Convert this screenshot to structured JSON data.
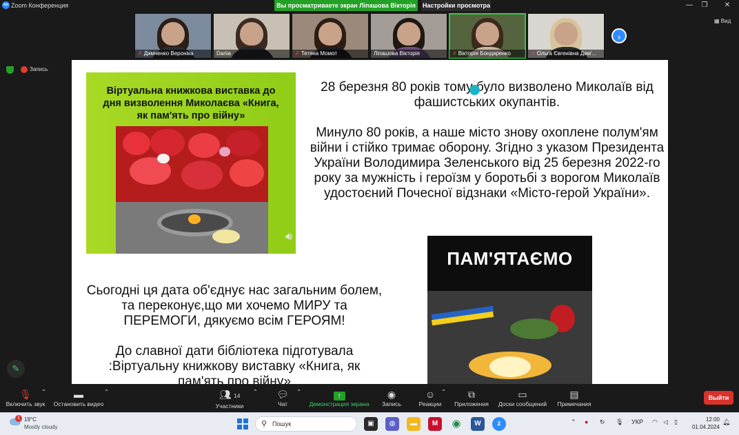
{
  "window": {
    "app_title": "Zoom Конференция",
    "logo": "zm",
    "share_banner": "Вы просматриваете экран Ліпашова Вікторія",
    "view_settings": "Настройки просмотра",
    "controls": [
      "—",
      "❐",
      "✕"
    ]
  },
  "participants": [
    {
      "name": "Димченко Вероніка",
      "muted": true,
      "bg": "#7d8b9e",
      "hair": "#2a1e17",
      "shirt": "#2c2c34"
    },
    {
      "name": "Dariia",
      "muted": false,
      "bg": "#c8c0b4",
      "hair": "#3a2a20",
      "shirt": "#26262a"
    },
    {
      "name": "Тетяна Момот",
      "muted": true,
      "bg": "#9b8a7c",
      "hair": "#2b1d14",
      "shirt": "#1d1d22"
    },
    {
      "name": "Ліпашова Вікторія",
      "muted": false,
      "bg": "#a49c96",
      "hair": "#1f1712",
      "shirt": "#6b4e7a"
    },
    {
      "name": "Вікторія Бондаренко",
      "muted": true,
      "bg": "#55643f",
      "hair": "#3b2a1c",
      "shirt": "#c7b8a4"
    },
    {
      "name": "Ольга Євгенівна Дем'...",
      "muted": true,
      "bg": "#d9d5d0",
      "hair": "#d8c49a",
      "shirt": "#2a2a2e"
    }
  ],
  "view_label": "Вид",
  "recording_label": "Запись",
  "slide": {
    "poster_title": "Віртуальна книжкова виставка до дня визволення Миколаєва «Книга, як пам'ять про війну»",
    "right_p1": "28 березня 80 років тому було визволено Миколаїв від фашистських окупантів.",
    "right_p2": "Минуло 80 років, а наше місто знову охоплене полум'ям війни і стійко тримає оборону. Згідно з указом Президента України Володимира Зеленського від 25 березня 2022-го року за мужність і героїзм у боротьбі з ворогом Миколаїв удостоєний Почесної відзнаки «Місто-герой України».",
    "left_p1": "Сьогодні ця дата об'єднує нас загальним болем, та переконує,що ми хочемо МИРУ та ПЕРЕМОГИ, дякуємо всім ГЕРОЯМ!",
    "left_p2": "До славної дати бібліотека підготувала :Віртуальну книжкову виставку «Книга, як пам'ять про війну»",
    "memorial_title": "ПАМ'ЯТАЄМО"
  },
  "toolbar": {
    "mute": "Включить звук",
    "video": "Остановить видео",
    "participants": "Участники",
    "participants_count": "14",
    "chat": "Чат",
    "share": "Демонстрация экрана",
    "record": "Запись",
    "reactions": "Реакции",
    "apps": "Приложения",
    "whiteboards": "Доски сообщений",
    "notes": "Примечания",
    "leave": "Выйти"
  },
  "taskbar": {
    "weather_temp": "19°C",
    "weather_cond": "Mostly cloudy",
    "weather_badge": "1",
    "search_placeholder": "Пошук",
    "lang": "УКР",
    "time": "12:00",
    "date": "01.04.2024"
  },
  "colors": {
    "zoom_blue": "#2d8cff",
    "share_green": "#23a127",
    "leave_red": "#d9322a",
    "poster_green": "#a8d925"
  }
}
